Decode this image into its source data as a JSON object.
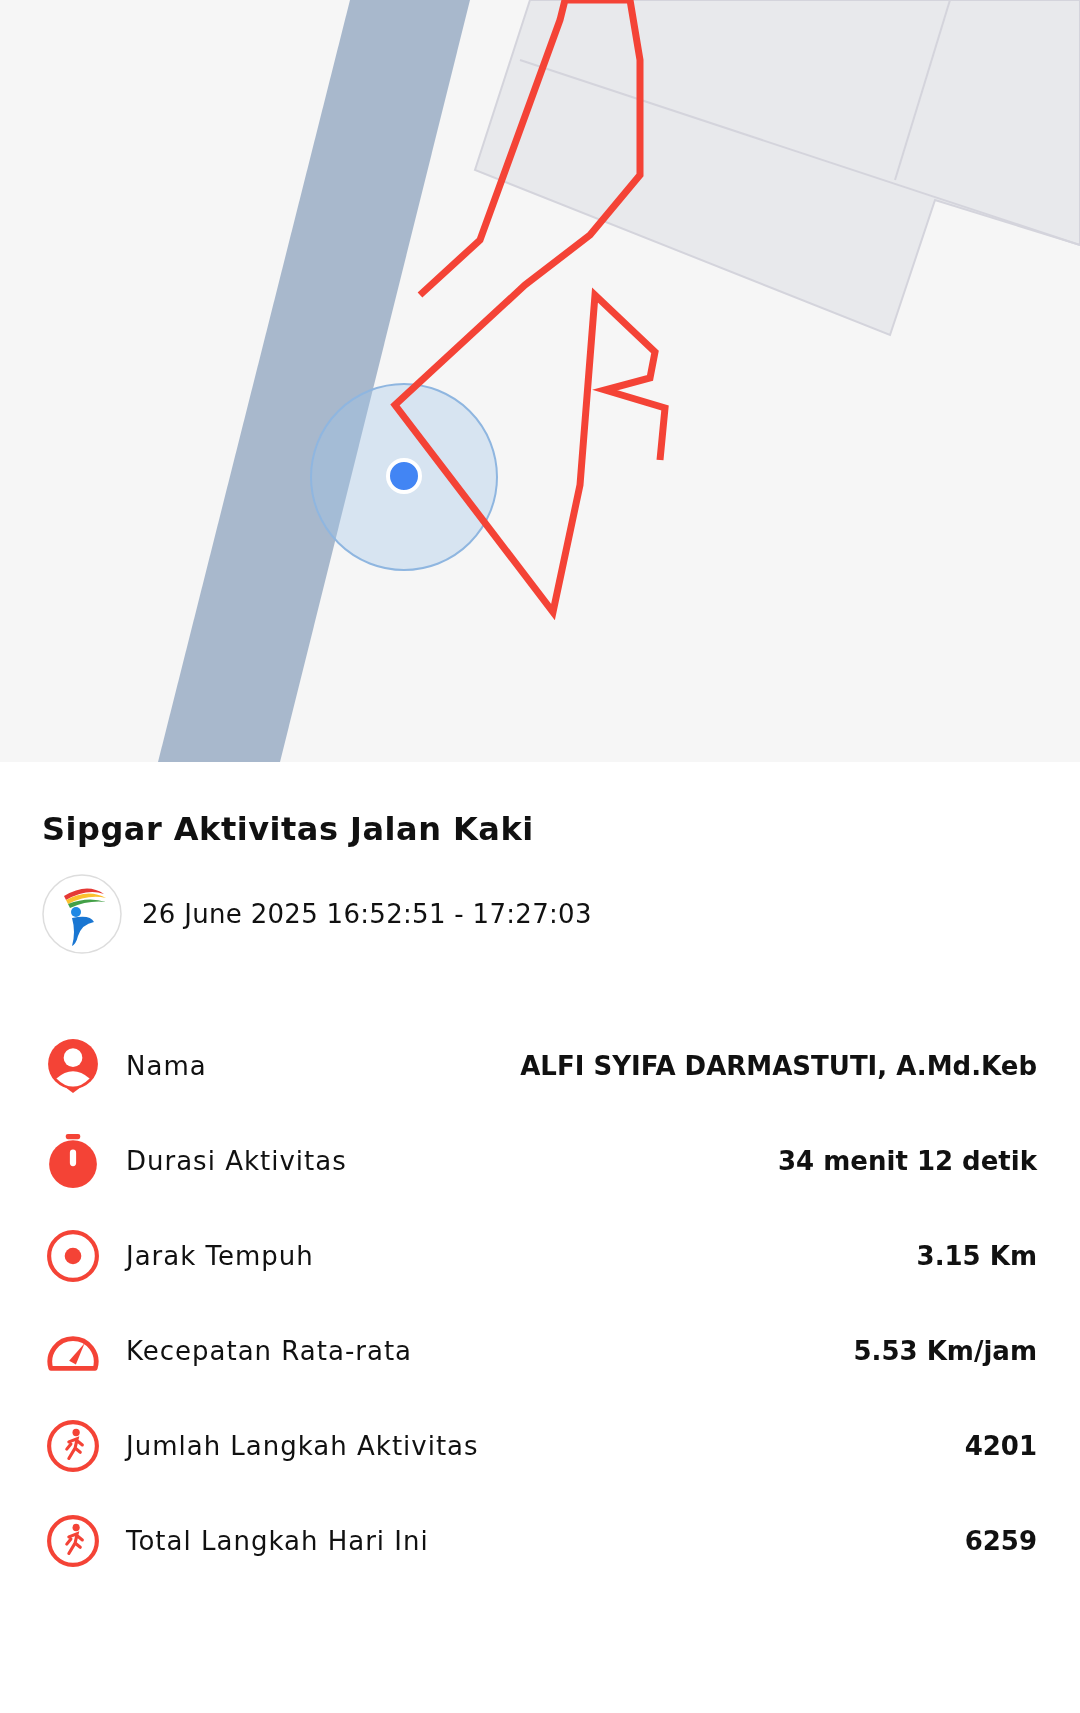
{
  "title": "Sipgar Aktivitas Jalan Kaki",
  "session": {
    "time_range": "26 June 2025 16:52:51 - 17:27:03"
  },
  "stats": [
    {
      "kind": "person",
      "label": "Nama",
      "value": "ALFI SYIFA DARMASTUTI, A.Md.Keb"
    },
    {
      "kind": "timer",
      "label": "Durasi Aktivitas",
      "value": "34 menit 12 detik"
    },
    {
      "kind": "target",
      "label": "Jarak Tempuh",
      "value": "3.15 Km"
    },
    {
      "kind": "speed",
      "label": "Kecepatan Rata-rata",
      "value": "5.53 Km/jam"
    },
    {
      "kind": "walk",
      "label": "Jumlah Langkah Aktivitas",
      "value": "4201"
    },
    {
      "kind": "walk",
      "label": "Total Langkah Hari Ini",
      "value": "6259"
    }
  ]
}
